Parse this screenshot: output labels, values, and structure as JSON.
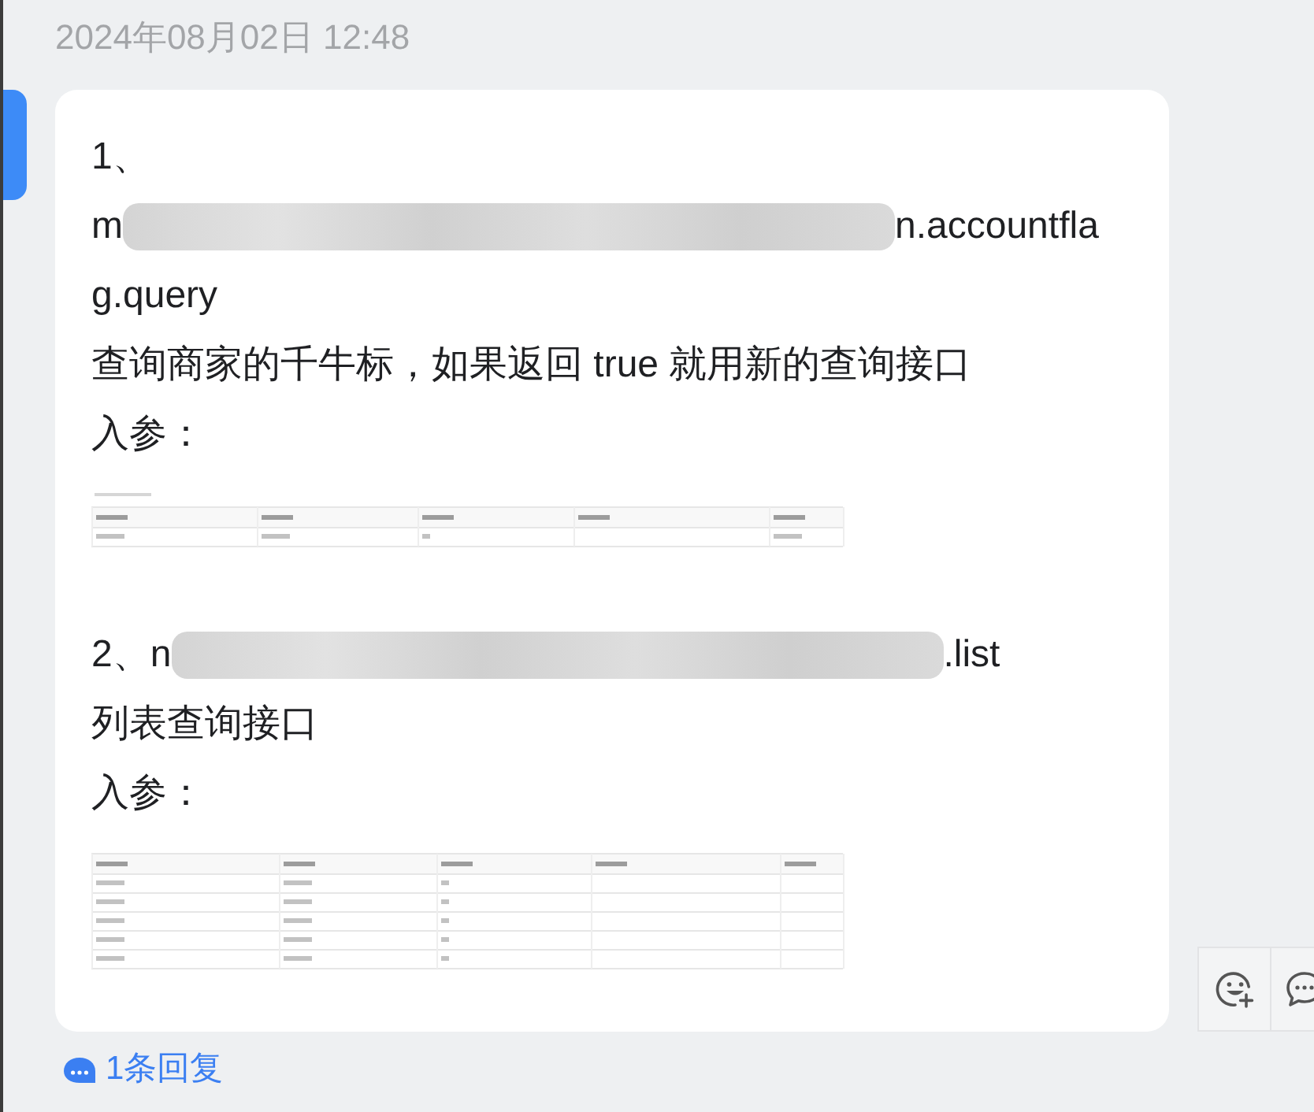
{
  "timestamp": "2024年08月02日 12:48",
  "message": {
    "selected": true,
    "blocks": [
      {
        "kind": "text",
        "text": "1、"
      },
      {
        "kind": "redacted",
        "before": "m",
        "after": "n.accountfla"
      },
      {
        "kind": "text",
        "text": "g.query"
      },
      {
        "kind": "text",
        "text": "查询商家的千牛标，如果返回 true 就用新的查询接口"
      },
      {
        "kind": "text",
        "text": "入参："
      },
      {
        "kind": "single_row_table"
      },
      {
        "kind": "redacted",
        "before": "2、n",
        "after": ".list"
      },
      {
        "kind": "text",
        "text": "列表查询接口"
      },
      {
        "kind": "text",
        "text": "入参："
      },
      {
        "kind": "multi_row_table"
      }
    ]
  },
  "replies": {
    "label": "1条回复"
  }
}
